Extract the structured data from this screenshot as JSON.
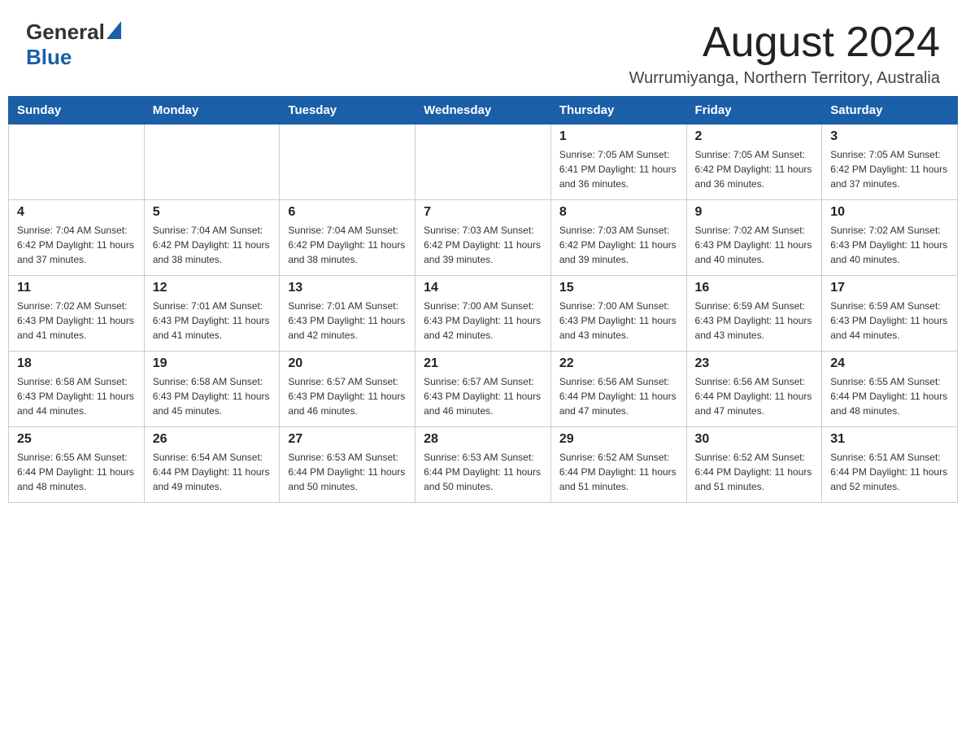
{
  "header": {
    "logo_general": "General",
    "logo_blue": "Blue",
    "month_title": "August 2024",
    "location": "Wurrumiyanga, Northern Territory, Australia"
  },
  "calendar": {
    "days_of_week": [
      "Sunday",
      "Monday",
      "Tuesday",
      "Wednesday",
      "Thursday",
      "Friday",
      "Saturday"
    ],
    "weeks": [
      [
        {
          "day": "",
          "info": ""
        },
        {
          "day": "",
          "info": ""
        },
        {
          "day": "",
          "info": ""
        },
        {
          "day": "",
          "info": ""
        },
        {
          "day": "1",
          "info": "Sunrise: 7:05 AM\nSunset: 6:41 PM\nDaylight: 11 hours and 36 minutes."
        },
        {
          "day": "2",
          "info": "Sunrise: 7:05 AM\nSunset: 6:42 PM\nDaylight: 11 hours and 36 minutes."
        },
        {
          "day": "3",
          "info": "Sunrise: 7:05 AM\nSunset: 6:42 PM\nDaylight: 11 hours and 37 minutes."
        }
      ],
      [
        {
          "day": "4",
          "info": "Sunrise: 7:04 AM\nSunset: 6:42 PM\nDaylight: 11 hours and 37 minutes."
        },
        {
          "day": "5",
          "info": "Sunrise: 7:04 AM\nSunset: 6:42 PM\nDaylight: 11 hours and 38 minutes."
        },
        {
          "day": "6",
          "info": "Sunrise: 7:04 AM\nSunset: 6:42 PM\nDaylight: 11 hours and 38 minutes."
        },
        {
          "day": "7",
          "info": "Sunrise: 7:03 AM\nSunset: 6:42 PM\nDaylight: 11 hours and 39 minutes."
        },
        {
          "day": "8",
          "info": "Sunrise: 7:03 AM\nSunset: 6:42 PM\nDaylight: 11 hours and 39 minutes."
        },
        {
          "day": "9",
          "info": "Sunrise: 7:02 AM\nSunset: 6:43 PM\nDaylight: 11 hours and 40 minutes."
        },
        {
          "day": "10",
          "info": "Sunrise: 7:02 AM\nSunset: 6:43 PM\nDaylight: 11 hours and 40 minutes."
        }
      ],
      [
        {
          "day": "11",
          "info": "Sunrise: 7:02 AM\nSunset: 6:43 PM\nDaylight: 11 hours and 41 minutes."
        },
        {
          "day": "12",
          "info": "Sunrise: 7:01 AM\nSunset: 6:43 PM\nDaylight: 11 hours and 41 minutes."
        },
        {
          "day": "13",
          "info": "Sunrise: 7:01 AM\nSunset: 6:43 PM\nDaylight: 11 hours and 42 minutes."
        },
        {
          "day": "14",
          "info": "Sunrise: 7:00 AM\nSunset: 6:43 PM\nDaylight: 11 hours and 42 minutes."
        },
        {
          "day": "15",
          "info": "Sunrise: 7:00 AM\nSunset: 6:43 PM\nDaylight: 11 hours and 43 minutes."
        },
        {
          "day": "16",
          "info": "Sunrise: 6:59 AM\nSunset: 6:43 PM\nDaylight: 11 hours and 43 minutes."
        },
        {
          "day": "17",
          "info": "Sunrise: 6:59 AM\nSunset: 6:43 PM\nDaylight: 11 hours and 44 minutes."
        }
      ],
      [
        {
          "day": "18",
          "info": "Sunrise: 6:58 AM\nSunset: 6:43 PM\nDaylight: 11 hours and 44 minutes."
        },
        {
          "day": "19",
          "info": "Sunrise: 6:58 AM\nSunset: 6:43 PM\nDaylight: 11 hours and 45 minutes."
        },
        {
          "day": "20",
          "info": "Sunrise: 6:57 AM\nSunset: 6:43 PM\nDaylight: 11 hours and 46 minutes."
        },
        {
          "day": "21",
          "info": "Sunrise: 6:57 AM\nSunset: 6:43 PM\nDaylight: 11 hours and 46 minutes."
        },
        {
          "day": "22",
          "info": "Sunrise: 6:56 AM\nSunset: 6:44 PM\nDaylight: 11 hours and 47 minutes."
        },
        {
          "day": "23",
          "info": "Sunrise: 6:56 AM\nSunset: 6:44 PM\nDaylight: 11 hours and 47 minutes."
        },
        {
          "day": "24",
          "info": "Sunrise: 6:55 AM\nSunset: 6:44 PM\nDaylight: 11 hours and 48 minutes."
        }
      ],
      [
        {
          "day": "25",
          "info": "Sunrise: 6:55 AM\nSunset: 6:44 PM\nDaylight: 11 hours and 48 minutes."
        },
        {
          "day": "26",
          "info": "Sunrise: 6:54 AM\nSunset: 6:44 PM\nDaylight: 11 hours and 49 minutes."
        },
        {
          "day": "27",
          "info": "Sunrise: 6:53 AM\nSunset: 6:44 PM\nDaylight: 11 hours and 50 minutes."
        },
        {
          "day": "28",
          "info": "Sunrise: 6:53 AM\nSunset: 6:44 PM\nDaylight: 11 hours and 50 minutes."
        },
        {
          "day": "29",
          "info": "Sunrise: 6:52 AM\nSunset: 6:44 PM\nDaylight: 11 hours and 51 minutes."
        },
        {
          "day": "30",
          "info": "Sunrise: 6:52 AM\nSunset: 6:44 PM\nDaylight: 11 hours and 51 minutes."
        },
        {
          "day": "31",
          "info": "Sunrise: 6:51 AM\nSunset: 6:44 PM\nDaylight: 11 hours and 52 minutes."
        }
      ]
    ]
  }
}
